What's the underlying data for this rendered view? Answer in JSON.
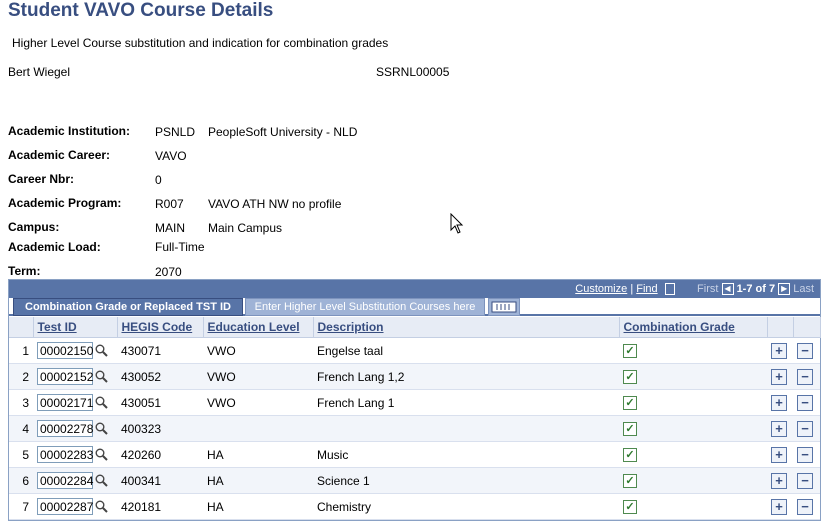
{
  "page": {
    "title": "Student VAVO Course Details",
    "subtitle": "Higher Level Course substitution and indication for combination grades"
  },
  "student": {
    "name": "Bert Wiegel",
    "id": "SSRNL00005"
  },
  "fields": [
    {
      "label": "Academic Institution:",
      "code": "PSNLD",
      "desc": "PeopleSoft University -  NLD"
    },
    {
      "label": "Academic Career:",
      "code": "VAVO",
      "desc": ""
    },
    {
      "label": "Career Nbr:",
      "code": "0",
      "desc": ""
    },
    {
      "label": "Academic Program:",
      "code": "R007",
      "desc": "VAVO ATH NW no profile"
    },
    {
      "label": "Campus:",
      "code": "MAIN",
      "desc": "Main Campus"
    },
    {
      "label": "Academic Load:",
      "code": "Full-Time",
      "desc": ""
    },
    {
      "label": "Term:",
      "code": "2070",
      "desc": ""
    }
  ],
  "grid": {
    "nav": {
      "customize": "Customize",
      "sep": "|",
      "find": "Find",
      "first": "First",
      "range": "1-7 of 7",
      "last": "Last"
    },
    "tabs": {
      "active": "Combination Grade or Replaced TST ID",
      "inactive": "Enter Higher Level Substitution Courses here"
    },
    "headers": {
      "test_id": "Test ID",
      "hegis": "HEGIS Code",
      "edu": "Education Level",
      "desc": "Description",
      "comb": "Combination Grade"
    },
    "rows": [
      {
        "n": "1",
        "test_id": "00002150",
        "hegis": "430071",
        "edu": "VWO",
        "desc": "Engelse taal",
        "checked": true
      },
      {
        "n": "2",
        "test_id": "00002152",
        "hegis": "430052",
        "edu": "VWO",
        "desc": "French Lang 1,2",
        "checked": true
      },
      {
        "n": "3",
        "test_id": "00002171",
        "hegis": "430051",
        "edu": "VWO",
        "desc": "French Lang 1",
        "checked": true
      },
      {
        "n": "4",
        "test_id": "00002278",
        "hegis": "400323",
        "edu": "",
        "desc": "",
        "checked": true
      },
      {
        "n": "5",
        "test_id": "00002283",
        "hegis": "420260",
        "edu": "HA",
        "desc": "Music",
        "checked": true
      },
      {
        "n": "6",
        "test_id": "00002284",
        "hegis": "400341",
        "edu": "HA",
        "desc": "Science 1",
        "checked": true
      },
      {
        "n": "7",
        "test_id": "00002287",
        "hegis": "420181",
        "edu": "HA",
        "desc": "Chemistry",
        "checked": true
      }
    ]
  },
  "colors": {
    "title": "#384e80",
    "grid_header": "#5874a7",
    "tab_inactive": "#9fb3d6"
  }
}
